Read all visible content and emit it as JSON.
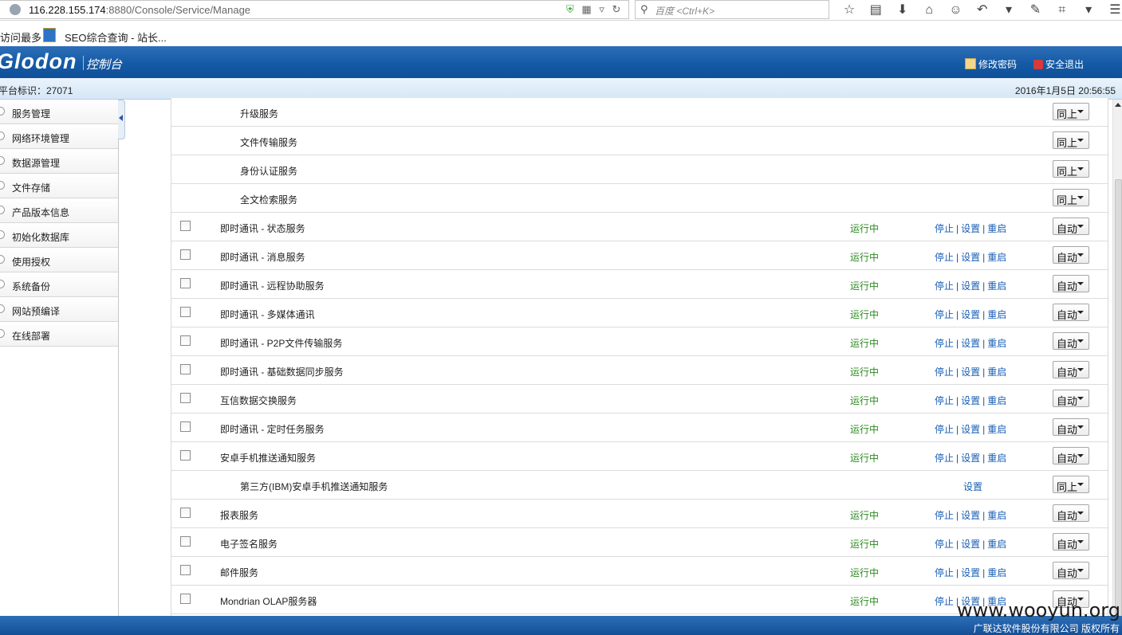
{
  "browser": {
    "url_host": "116.228.155.174",
    "url_path": ":8880/Console/Service/Manage",
    "search_placeholder": "百度 <Ctrl+K>",
    "bookmarks": [
      "访问最多",
      "SEO综合查询 - 站长..."
    ]
  },
  "header": {
    "logo": "Glodon",
    "title": "控制台",
    "change_password": "修改密码",
    "logout": "安全退出"
  },
  "info_bar": {
    "platform_id": "平台标识：27071",
    "datetime": "2016年1月5日 20:56:55"
  },
  "sidebar": {
    "items": [
      {
        "label": "服务管理"
      },
      {
        "label": "网络环境管理"
      },
      {
        "label": "数据源管理"
      },
      {
        "label": "文件存储"
      },
      {
        "label": "产品版本信息"
      },
      {
        "label": "初始化数据库"
      },
      {
        "label": "使用授权"
      },
      {
        "label": "系统备份"
      },
      {
        "label": "网站预编译"
      },
      {
        "label": "在线部署"
      }
    ]
  },
  "labels": {
    "running": "运行中",
    "stop": "停止",
    "settings": "设置",
    "restart": "重启",
    "sep": "|"
  },
  "services": [
    {
      "name": "升级服务",
      "sub": true,
      "mode": "同上"
    },
    {
      "name": "文件传输服务",
      "sub": true,
      "mode": "同上"
    },
    {
      "name": "身份认证服务",
      "sub": true,
      "mode": "同上"
    },
    {
      "name": "全文检索服务",
      "sub": true,
      "mode": "同上"
    },
    {
      "name": "即时通讯 - 状态服务",
      "sub": false,
      "mode": "自动"
    },
    {
      "name": "即时通讯 - 消息服务",
      "sub": false,
      "mode": "自动"
    },
    {
      "name": "即时通讯 - 远程协助服务",
      "sub": false,
      "mode": "自动"
    },
    {
      "name": "即时通讯 - 多媒体通讯",
      "sub": false,
      "mode": "自动"
    },
    {
      "name": "即时通讯 - P2P文件传输服务",
      "sub": false,
      "mode": "自动"
    },
    {
      "name": "即时通讯 - 基础数据同步服务",
      "sub": false,
      "mode": "自动"
    },
    {
      "name": "互信数据交换服务",
      "sub": false,
      "mode": "自动"
    },
    {
      "name": "即时通讯 - 定时任务服务",
      "sub": false,
      "mode": "自动"
    },
    {
      "name": "安卓手机推送通知服务",
      "sub": false,
      "mode": "自动"
    },
    {
      "name": "第三方(IBM)安卓手机推送通知服务",
      "sub": true,
      "settings_only": true,
      "mode": "同上"
    },
    {
      "name": "报表服务",
      "sub": false,
      "mode": "自动"
    },
    {
      "name": "电子签名服务",
      "sub": false,
      "mode": "自动"
    },
    {
      "name": "邮件服务",
      "sub": false,
      "mode": "自动"
    },
    {
      "name": "Mondrian OLAP服务器",
      "sub": false,
      "mode": "自动"
    }
  ],
  "footer": {
    "copyright": "广联达软件股份有限公司 版权所有",
    "watermark": "www.wooyun.org"
  }
}
